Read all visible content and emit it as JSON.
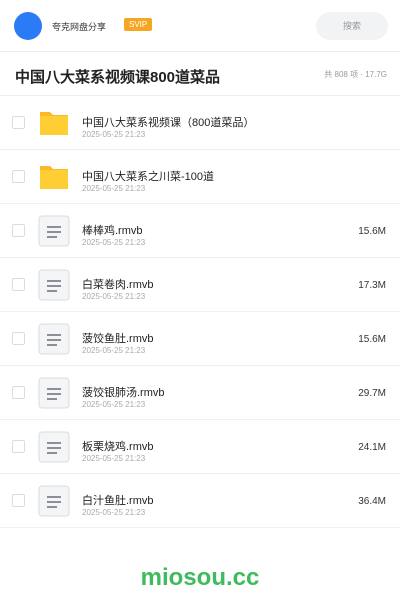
{
  "header": {
    "username": "夸克网盘分享",
    "badge": "SVIP",
    "search_placeholder": "搜索",
    "accent_color": "#2b7bf7",
    "badge_color": "#f5a623"
  },
  "folder": {
    "title": "中国八大菜系视频课800道菜品",
    "meta": "共 808 项 · 17.7G"
  },
  "files": [
    {
      "icon": "folder-icon",
      "name": "中国八大菜系视频课（800道菜品）",
      "date": "2025-05-25 21:23",
      "size": ""
    },
    {
      "icon": "folder-icon",
      "name": "中国八大菜系之川菜-100道",
      "date": "2025-05-25 21:23",
      "size": ""
    },
    {
      "icon": "file-icon",
      "name": "棒棒鸡.rmvb",
      "date": "2025-05-25 21:23",
      "size": "15.6M"
    },
    {
      "icon": "file-icon",
      "name": "白菜卷肉.rmvb",
      "date": "2025-05-25 21:23",
      "size": "17.3M"
    },
    {
      "icon": "file-icon",
      "name": "菠饺鱼肚.rmvb",
      "date": "2025-05-25 21:23",
      "size": "15.6M"
    },
    {
      "icon": "file-icon",
      "name": "菠饺银肺汤.rmvb",
      "date": "2025-05-25 21:23",
      "size": "29.7M"
    },
    {
      "icon": "file-icon",
      "name": "板栗烧鸡.rmvb",
      "date": "2025-05-25 21:23",
      "size": "24.1M"
    },
    {
      "icon": "file-icon",
      "name": "白汁鱼肚.rmvb",
      "date": "2025-05-25 21:23",
      "size": "36.4M"
    }
  ],
  "watermark": "miosou.cc"
}
